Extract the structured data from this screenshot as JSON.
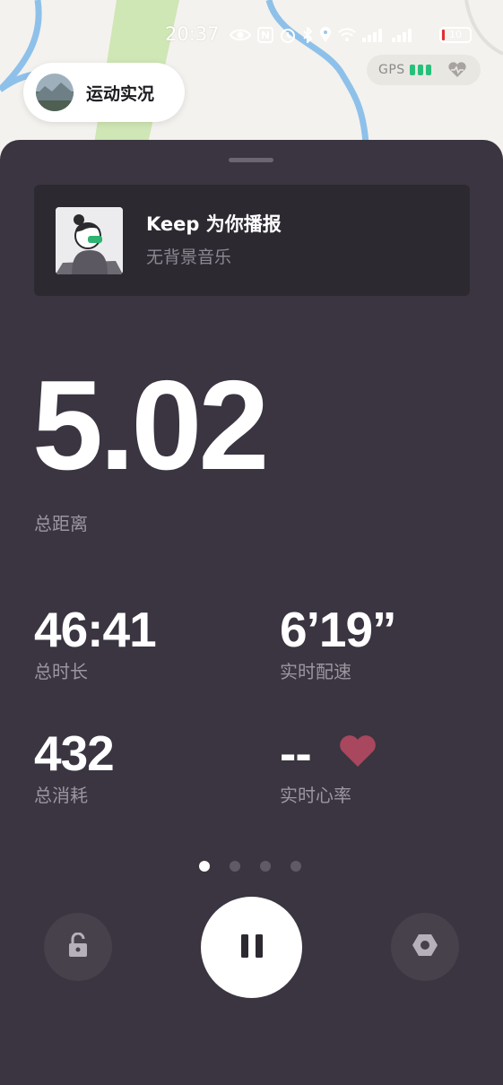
{
  "status_bar": {
    "time": "20:37",
    "battery": "10",
    "icons": [
      "eye-icon",
      "nfc-icon",
      "alarm-icon",
      "bluetooth-icon",
      "location-icon",
      "wifi-icon",
      "signal-icon",
      "signal-icon"
    ]
  },
  "top": {
    "live_label": "运动实况",
    "gps_label": "GPS",
    "gps_bars": 3
  },
  "music": {
    "title": "Keep 为你播报",
    "subtitle": "无背景音乐"
  },
  "distance": {
    "value": "5.02",
    "label": "总距离"
  },
  "stats": {
    "duration": {
      "value": "46:41",
      "label": "总时长"
    },
    "pace": {
      "value": "6’19”",
      "label": "实时配速"
    },
    "calories": {
      "value": "432",
      "label": "总消耗"
    },
    "heart_rate": {
      "value": "--",
      "label": "实时心率"
    }
  },
  "pager": {
    "count": 4,
    "active": 0
  },
  "colors": {
    "sheet": "#3a3540",
    "card": "#2d2931",
    "label": "#9b96a0",
    "heart": "#a8475d",
    "gps_green": "#27c07a",
    "map_road": "#8ec1ea",
    "map_park": "#cfe6b5"
  }
}
